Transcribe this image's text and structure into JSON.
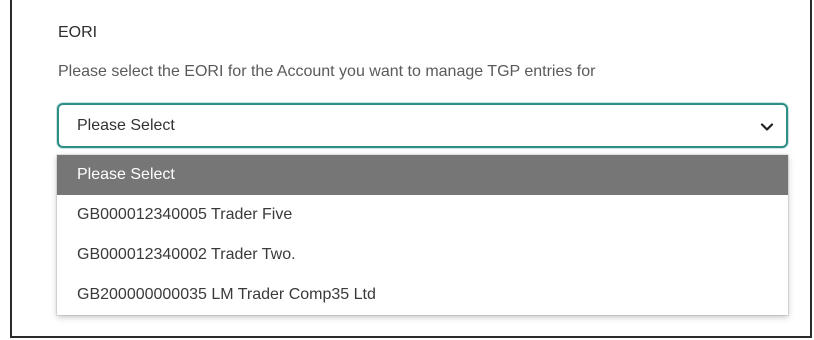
{
  "field": {
    "label": "EORI",
    "hint": "Please select the EORI for the Account you want to manage TGP entries for"
  },
  "select": {
    "value": "Please Select",
    "icon": "chevron-down-icon",
    "border_color": "#2e8f86"
  },
  "dropdown": {
    "options": [
      {
        "label": "Please Select",
        "selected": true
      },
      {
        "label": "GB000012340005 Trader Five",
        "selected": false
      },
      {
        "label": "GB000012340002 Trader Two.",
        "selected": false
      },
      {
        "label": "GB200000000035 LM Trader Comp35 Ltd",
        "selected": false
      }
    ],
    "selected_bg": "#767676"
  }
}
